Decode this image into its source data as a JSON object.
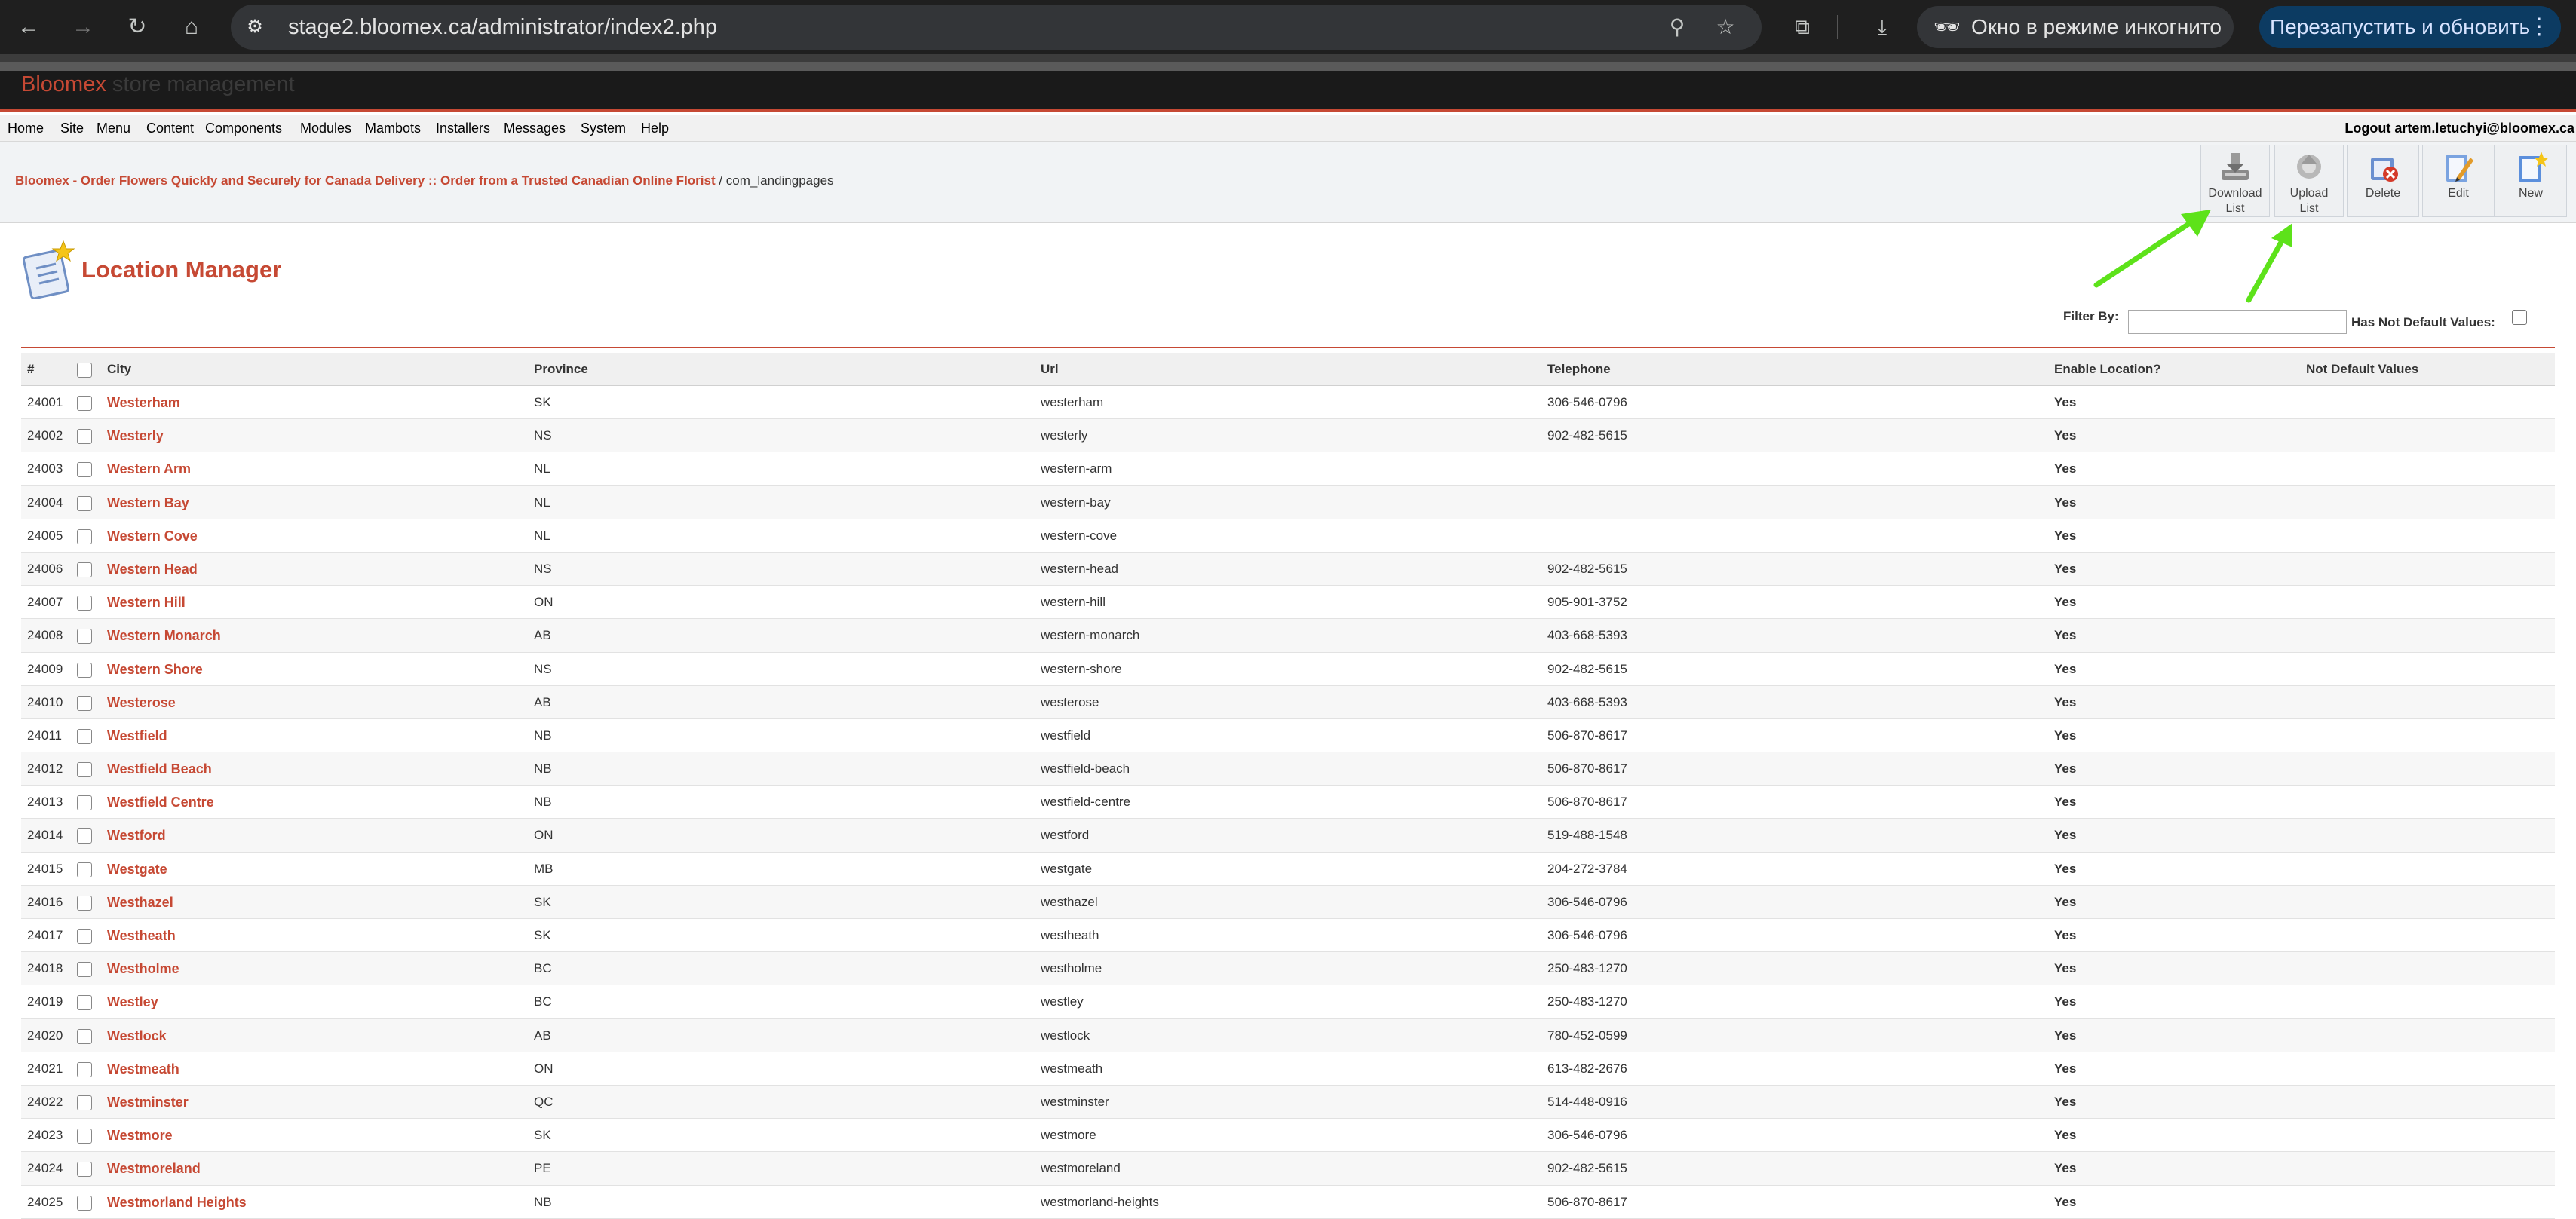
{
  "browser": {
    "url": "stage2.bloomex.ca/administrator/index2.php",
    "incognito_label": "Окно в режиме инкогнито",
    "relaunch_label": "Перезапустить и обновить"
  },
  "banner": {
    "brand": "Bloomex",
    "subtitle": " store management"
  },
  "menu": {
    "items": [
      "Home",
      "Site",
      "Menu",
      "Content",
      "Components",
      "Modules",
      "Mambots",
      "Installers",
      "Messages",
      "System",
      "Help"
    ],
    "logout": "Logout artem.letuchyi@bloomex.ca"
  },
  "breadcrumb": {
    "link": "Bloomex - Order Flowers Quickly and Securely for Canada Delivery :: Order from a Trusted Canadian Online Florist",
    "current": " / com_landingpages"
  },
  "toolbar": {
    "download_line1": "Download",
    "download_line2": "List",
    "upload_line1": "Upload",
    "upload_line2": "List",
    "delete": "Delete",
    "edit": "Edit",
    "new": "New"
  },
  "page": {
    "title": "Location Manager",
    "filter_label": "Filter By:",
    "filter_value": "",
    "has_not_default_label": "Has Not Default Values:"
  },
  "table": {
    "headers": [
      "#",
      "City",
      "Province",
      "Url",
      "Telephone",
      "Enable Location?",
      "Not Default Values"
    ],
    "rows": [
      {
        "num": "24001",
        "city": "Westerham",
        "prov": "SK",
        "url": "westerham",
        "tel": "306-546-0796",
        "enabled": "Yes"
      },
      {
        "num": "24002",
        "city": "Westerly",
        "prov": "NS",
        "url": "westerly",
        "tel": "902-482-5615",
        "enabled": "Yes"
      },
      {
        "num": "24003",
        "city": "Western Arm",
        "prov": "NL",
        "url": "western-arm",
        "tel": "",
        "enabled": "Yes"
      },
      {
        "num": "24004",
        "city": "Western Bay",
        "prov": "NL",
        "url": "western-bay",
        "tel": "",
        "enabled": "Yes"
      },
      {
        "num": "24005",
        "city": "Western Cove",
        "prov": "NL",
        "url": "western-cove",
        "tel": "",
        "enabled": "Yes"
      },
      {
        "num": "24006",
        "city": "Western Head",
        "prov": "NS",
        "url": "western-head",
        "tel": "902-482-5615",
        "enabled": "Yes"
      },
      {
        "num": "24007",
        "city": "Western Hill",
        "prov": "ON",
        "url": "western-hill",
        "tel": "905-901-3752",
        "enabled": "Yes"
      },
      {
        "num": "24008",
        "city": "Western Monarch",
        "prov": "AB",
        "url": "western-monarch",
        "tel": "403-668-5393",
        "enabled": "Yes"
      },
      {
        "num": "24009",
        "city": "Western Shore",
        "prov": "NS",
        "url": "western-shore",
        "tel": "902-482-5615",
        "enabled": "Yes"
      },
      {
        "num": "24010",
        "city": "Westerose",
        "prov": "AB",
        "url": "westerose",
        "tel": "403-668-5393",
        "enabled": "Yes"
      },
      {
        "num": "24011",
        "city": "Westfield",
        "prov": "NB",
        "url": "westfield",
        "tel": "506-870-8617",
        "enabled": "Yes"
      },
      {
        "num": "24012",
        "city": "Westfield Beach",
        "prov": "NB",
        "url": "westfield-beach",
        "tel": "506-870-8617",
        "enabled": "Yes"
      },
      {
        "num": "24013",
        "city": "Westfield Centre",
        "prov": "NB",
        "url": "westfield-centre",
        "tel": "506-870-8617",
        "enabled": "Yes"
      },
      {
        "num": "24014",
        "city": "Westford",
        "prov": "ON",
        "url": "westford",
        "tel": "519-488-1548",
        "enabled": "Yes"
      },
      {
        "num": "24015",
        "city": "Westgate",
        "prov": "MB",
        "url": "westgate",
        "tel": "204-272-3784",
        "enabled": "Yes"
      },
      {
        "num": "24016",
        "city": "Westhazel",
        "prov": "SK",
        "url": "westhazel",
        "tel": "306-546-0796",
        "enabled": "Yes"
      },
      {
        "num": "24017",
        "city": "Westheath",
        "prov": "SK",
        "url": "westheath",
        "tel": "306-546-0796",
        "enabled": "Yes"
      },
      {
        "num": "24018",
        "city": "Westholme",
        "prov": "BC",
        "url": "westholme",
        "tel": "250-483-1270",
        "enabled": "Yes"
      },
      {
        "num": "24019",
        "city": "Westley",
        "prov": "BC",
        "url": "westley",
        "tel": "250-483-1270",
        "enabled": "Yes"
      },
      {
        "num": "24020",
        "city": "Westlock",
        "prov": "AB",
        "url": "westlock",
        "tel": "780-452-0599",
        "enabled": "Yes"
      },
      {
        "num": "24021",
        "city": "Westmeath",
        "prov": "ON",
        "url": "westmeath",
        "tel": "613-482-2676",
        "enabled": "Yes"
      },
      {
        "num": "24022",
        "city": "Westminster",
        "prov": "QC",
        "url": "westminster",
        "tel": "514-448-0916",
        "enabled": "Yes"
      },
      {
        "num": "24023",
        "city": "Westmore",
        "prov": "SK",
        "url": "westmore",
        "tel": "306-546-0796",
        "enabled": "Yes"
      },
      {
        "num": "24024",
        "city": "Westmoreland",
        "prov": "PE",
        "url": "westmoreland",
        "tel": "902-482-5615",
        "enabled": "Yes"
      },
      {
        "num": "24025",
        "city": "Westmorland Heights",
        "prov": "NB",
        "url": "westmorland-heights",
        "tel": "506-870-8617",
        "enabled": "Yes"
      }
    ]
  },
  "colors": {
    "brand_red": "#c64934",
    "annotation_arrow": "#5de21a",
    "relaunch_bg": "#0c3b62"
  },
  "icons": {
    "download": "download-list-icon",
    "upload": "upload-list-icon",
    "delete": "delete-icon",
    "edit": "edit-icon",
    "new": "new-icon",
    "page": "location-manager-icon"
  }
}
